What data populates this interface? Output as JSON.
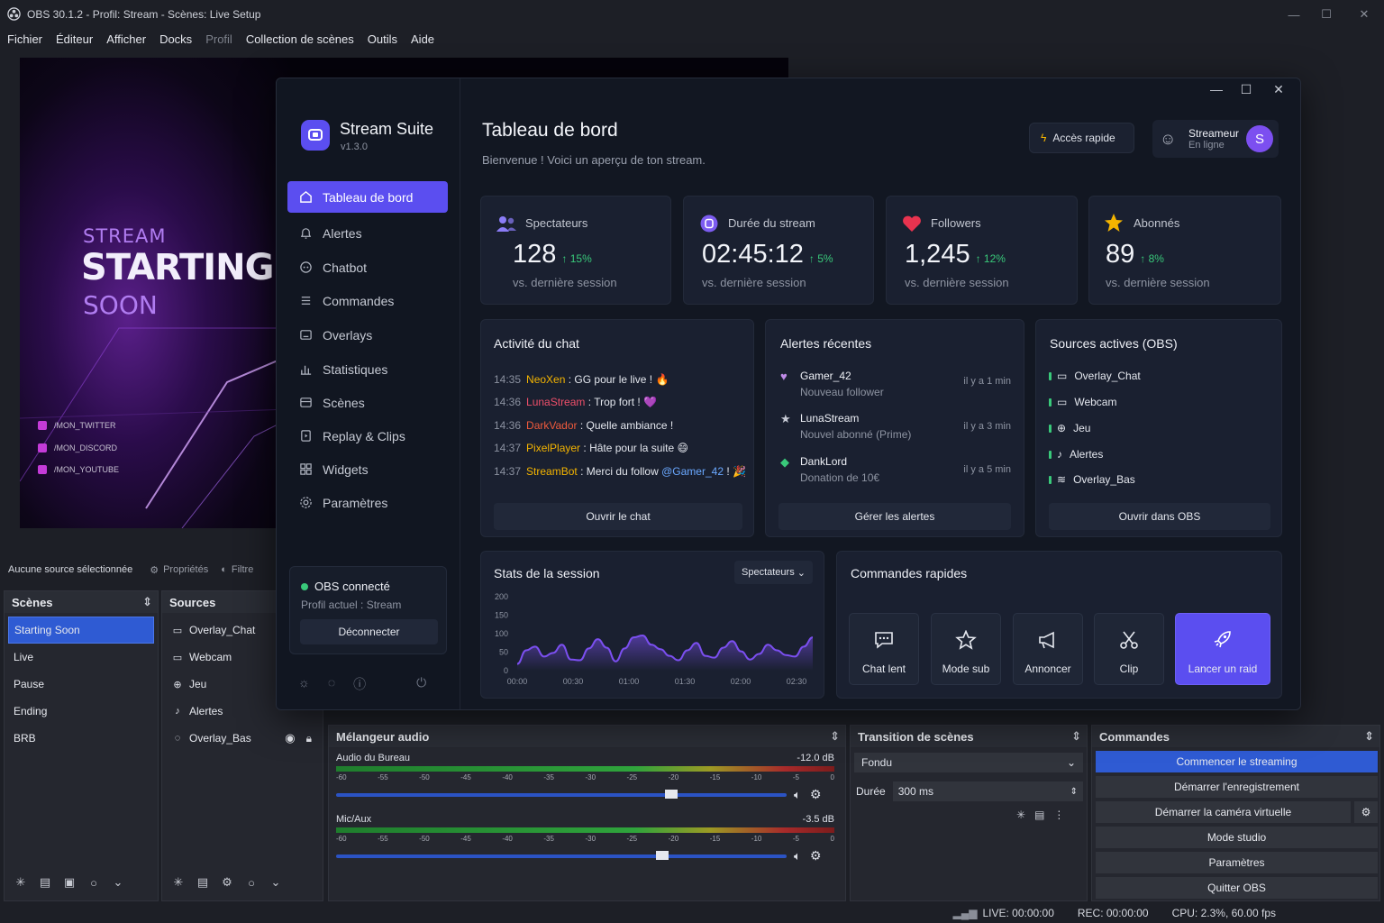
{
  "obs": {
    "title": "OBS 30.1.2 - Profil: Stream - Scènes: Live Setup",
    "menu": [
      "Fichier",
      "Éditeur",
      "Afficher",
      "Docks",
      "Profil",
      "Collection de scènes",
      "Outils",
      "Aide"
    ],
    "preview": {
      "line1": "STREAM",
      "line2": "STARTING",
      "line3": "SOON",
      "socials": [
        "/MON_TWITTER",
        "/MON_DISCORD",
        "/MON_YOUTUBE"
      ]
    },
    "no_source": "Aucune source sélectionnée",
    "properties": "Propriétés",
    "filters": "Filtre",
    "scenes_title": "Scènes",
    "scenes": [
      "Starting Soon",
      "Live",
      "Pause",
      "Ending",
      "BRB"
    ],
    "sources_title": "Sources",
    "sources": [
      "Overlay_Chat",
      "Webcam",
      "Jeu",
      "Alertes",
      "Overlay_Bas"
    ],
    "mixer": {
      "title": "Mélangeur audio",
      "ch1_name": "Audio du Bureau",
      "ch1_db": "-12.0 dB",
      "ch1_level": 0.73,
      "ch2_name": "Mic/Aux",
      "ch2_db": "-3.5 dB",
      "ch2_level": 0.71,
      "ticks": [
        "-60",
        "-55",
        "-50",
        "-45",
        "-40",
        "-35",
        "-30",
        "-25",
        "-20",
        "-15",
        "-10",
        "-5",
        "0"
      ]
    },
    "transition": {
      "title": "Transition de scènes",
      "type": "Fondu",
      "duration_label": "Durée",
      "duration": "300 ms"
    },
    "commands": {
      "title": "Commandes",
      "buttons": [
        "Commencer le streaming",
        "Démarrer l'enregistrement",
        "Démarrer la caméra virtuelle",
        "Mode studio",
        "Paramètres",
        "Quitter OBS"
      ]
    },
    "status": {
      "live": "LIVE: 00:00:00",
      "rec": "REC: 00:00:00",
      "cpu": "CPU: 2.3%, 60.00 fps"
    }
  },
  "suite": {
    "name": "Stream Suite",
    "version": "v1.3.0",
    "nav": [
      "Tableau de bord",
      "Alertes",
      "Chatbot",
      "Commandes",
      "Overlays",
      "Statistiques",
      "Scènes",
      "Replay & Clips",
      "Widgets",
      "Paramètres"
    ],
    "obs_status": "OBS connecté",
    "profile": "Profil actuel : Stream",
    "disconnect": "Déconnecter",
    "page_title": "Tableau de bord",
    "welcome": "Bienvenue ! Voici un aperçu de ton stream.",
    "quick_access": "Accès rapide",
    "user": {
      "name": "Streameur",
      "status": "En ligne",
      "initial": "S"
    },
    "stats": [
      {
        "label": "Spectateurs",
        "value": "128",
        "delta": "↑ 15%",
        "sub": "vs. dernière session",
        "color": "#8b7cf6"
      },
      {
        "label": "Durée du stream",
        "value": "02:45:12",
        "delta": "↑ 5%",
        "sub": "vs. dernière session",
        "color": "#7c5cf0"
      },
      {
        "label": "Followers",
        "value": "1,245",
        "delta": "↑ 12%",
        "sub": "vs. dernière session",
        "color": "#e8334f"
      },
      {
        "label": "Abonnés",
        "value": "89",
        "delta": "↑ 8%",
        "sub": "vs. dernière session",
        "color": "#f4b400"
      }
    ],
    "chat": {
      "title": "Activité du chat",
      "messages": [
        {
          "time": "14:35",
          "user": "NeoXen",
          "color": "#f4b400",
          "text": " : GG pour le live ! 🔥"
        },
        {
          "time": "14:36",
          "user": "LunaStream",
          "color": "#ef4f6a",
          "text": " : Trop fort ! 💜"
        },
        {
          "time": "14:36",
          "user": "DarkVador",
          "color": "#ef5a3c",
          "text": " : Quelle ambiance !"
        },
        {
          "time": "14:37",
          "user": "PixelPlayer",
          "color": "#f4b400",
          "text": " : Hâte pour la suite 😄"
        },
        {
          "time": "14:37",
          "user": "StreamBot",
          "color": "#f4b400",
          "text": " : Merci du follow ",
          "mention": "@Gamer_42",
          "tail": " ! 🎉"
        }
      ],
      "button": "Ouvrir le chat"
    },
    "alerts": {
      "title": "Alertes récentes",
      "items": [
        {
          "name": "Gamer_42",
          "desc": "Nouveau follower",
          "time": "il y a 1 min",
          "color": "#c08be8"
        },
        {
          "name": "LunaStream",
          "desc": "Nouvel abonné (Prime)",
          "time": "il y a 3 min",
          "color": "#c8ccd6"
        },
        {
          "name": "DankLord",
          "desc": "Donation de 10€",
          "time": "il y a 5 min",
          "color": "#39c97a"
        }
      ],
      "button": "Gérer les alertes"
    },
    "sources": {
      "title": "Sources actives (OBS)",
      "items": [
        "Overlay_Chat",
        "Webcam",
        "Jeu",
        "Alertes",
        "Overlay_Bas"
      ],
      "button": "Ouvrir dans OBS"
    },
    "session": {
      "title": "Stats de la session",
      "select": "Spectateurs"
    },
    "quick": {
      "title": "Commandes rapides",
      "buttons": [
        "Chat lent",
        "Mode sub",
        "Annoncer",
        "Clip",
        "Lancer un raid"
      ]
    }
  },
  "chart_data": {
    "type": "line",
    "title": "Stats de la session",
    "series": [
      {
        "name": "Spectateurs",
        "values": [
          18,
          55,
          65,
          38,
          48,
          70,
          30,
          28,
          60,
          85,
          62,
          25,
          60,
          90,
          95,
          70,
          58,
          40,
          28,
          55,
          75,
          40,
          35,
          62,
          80,
          52,
          30,
          45,
          70,
          55,
          42,
          38,
          65,
          90
        ]
      }
    ],
    "x_start_min": 0,
    "x_end_min": 165,
    "xticks": [
      "00:00",
      "00:30",
      "01:00",
      "01:30",
      "02:00",
      "02:30"
    ],
    "yticks": [
      "0",
      "50",
      "100",
      "150",
      "200"
    ],
    "ylim": [
      0,
      200
    ],
    "fill": true,
    "color": "#7b4ff0"
  }
}
